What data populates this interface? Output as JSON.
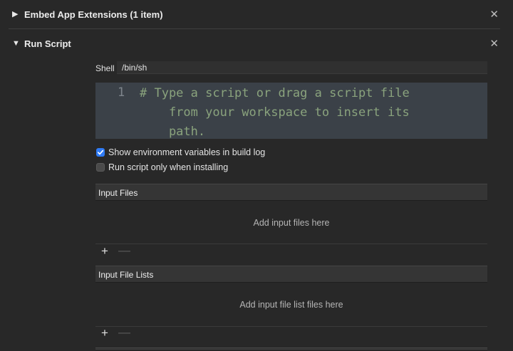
{
  "phases": {
    "embed": {
      "title": "Embed App Extensions (1 item)",
      "disclosure_glyph": "▶",
      "close_glyph": "✕"
    },
    "run_script": {
      "title": "Run Script",
      "disclosure_glyph": "▼",
      "close_glyph": "✕"
    }
  },
  "shell": {
    "label": "Shell",
    "value": "/bin/sh"
  },
  "editor": {
    "line_number": "1",
    "code": "# Type a script or drag a script file\n    from your workspace to insert its\n    path."
  },
  "options": {
    "show_env_label": "Show environment variables in build log",
    "show_env_checked": true,
    "install_only_label": "Run script only when installing",
    "install_only_checked": false
  },
  "input_files": {
    "header": "Input Files",
    "placeholder": "Add input files here",
    "add_glyph": "+",
    "remove_glyph": "—"
  },
  "input_file_lists": {
    "header": "Input File Lists",
    "placeholder": "Add input file list files here",
    "add_glyph": "+",
    "remove_glyph": "—"
  },
  "colors": {
    "background": "#282828",
    "editor_bg": "#3b4148",
    "comment_text": "#8aa37d",
    "checkbox_accent": "#2f7bf5"
  }
}
